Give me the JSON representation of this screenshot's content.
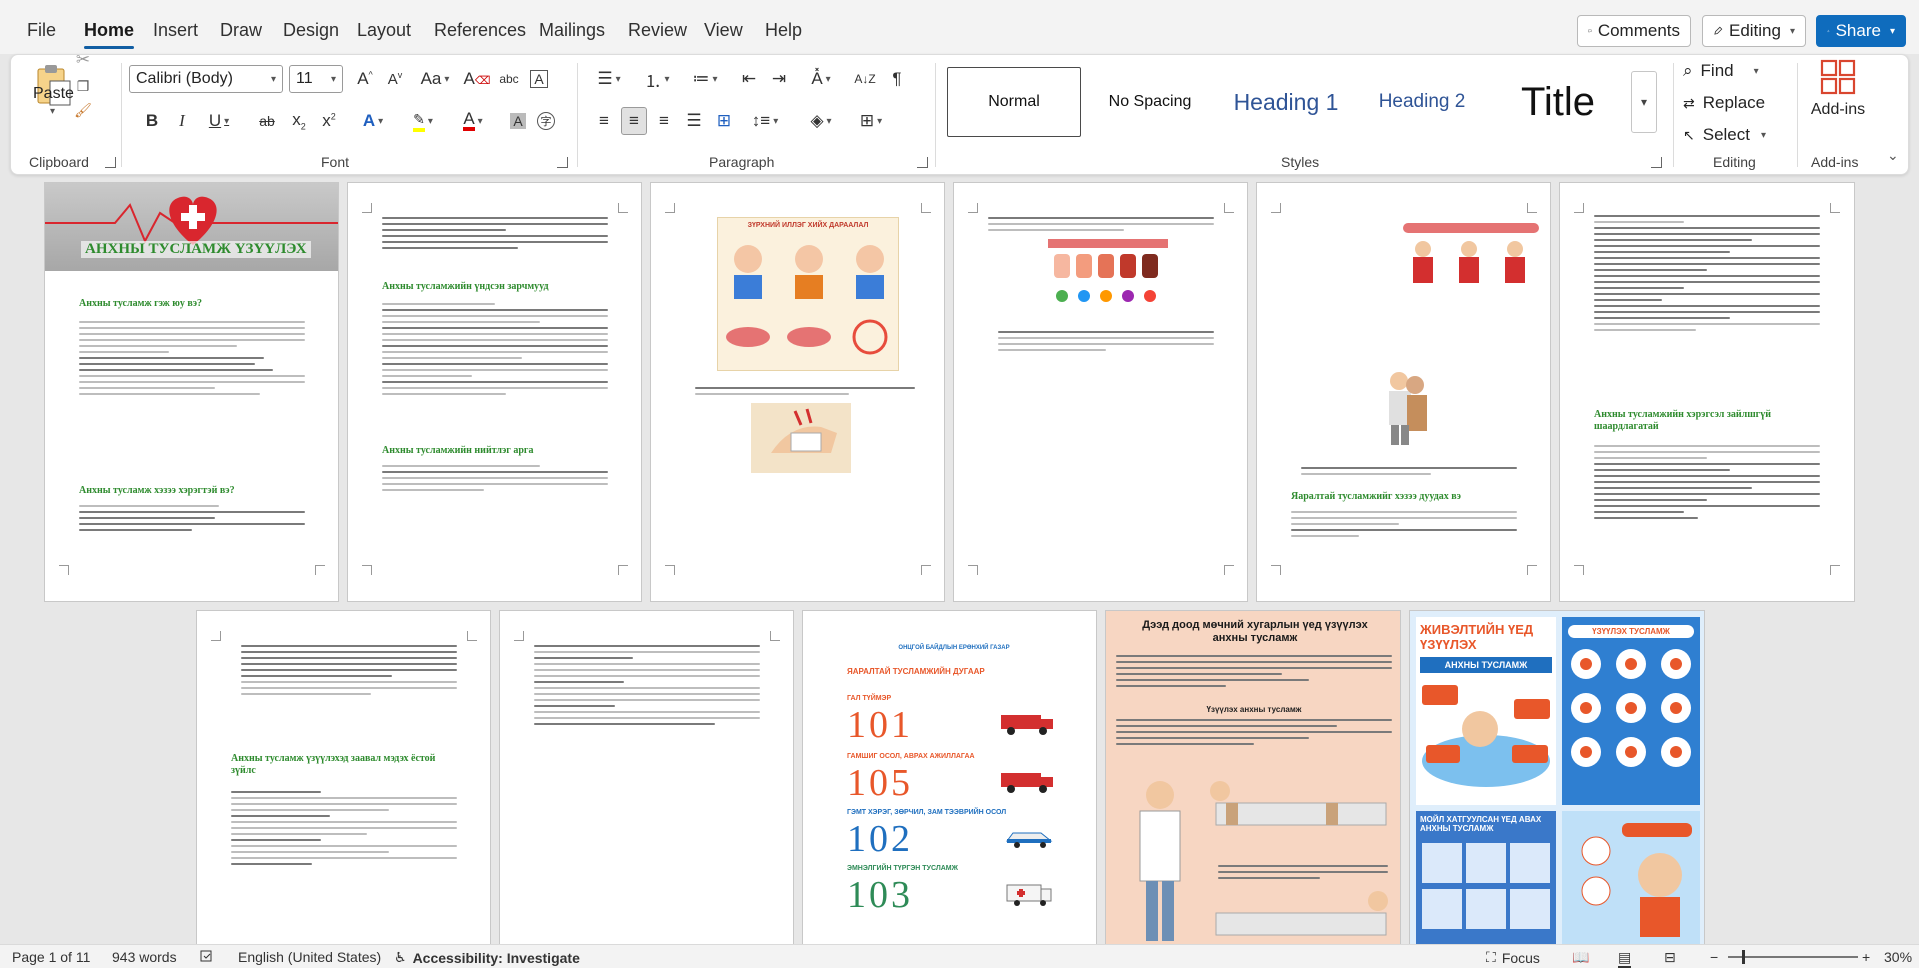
{
  "menu": {
    "tabs": [
      "File",
      "Home",
      "Insert",
      "Draw",
      "Design",
      "Layout",
      "References",
      "Mailings",
      "Review",
      "View",
      "Help"
    ],
    "active_tab": "Home",
    "comments_label": "Comments",
    "editing_label": "Editing",
    "share_label": "Share"
  },
  "ribbon": {
    "clipboard": {
      "paste_label": "Paste",
      "group_label": "Clipboard"
    },
    "font": {
      "font_name": "Calibri (Body)",
      "font_size": "11",
      "group_label": "Font"
    },
    "paragraph": {
      "group_label": "Paragraph"
    },
    "styles": {
      "items": [
        "Normal",
        "No Spacing",
        "Heading 1",
        "Heading 2",
        "Title"
      ],
      "group_label": "Styles"
    },
    "editing": {
      "find_label": "Find",
      "replace_label": "Replace",
      "select_label": "Select",
      "group_label": "Editing"
    },
    "addins": {
      "label": "Add-ins",
      "group_label": "Add-ins"
    }
  },
  "colors": {
    "accent": "#0f6cbd",
    "heading_green": "#2e8b2e",
    "poster_orange": "#e8572a",
    "poster_blue": "#1f6fbf",
    "cover_red": "#d9262e"
  },
  "pages": {
    "p1": {
      "title": "АНХНЫ ТУСЛАМЖ ҮЗҮҮЛЭХ",
      "h1": "Анхны тусламж гэж юу вэ?",
      "h2": "Анхны тусламж хэзээ хэрэгтэй вэ?"
    },
    "p2": {
      "h1": "Анхны тусламжийн үндсэн зарчмууд",
      "h2": "Анхны тусламжийн нийтлэг арга"
    },
    "p3": {
      "poster_title": "ЗҮРХНИЙ ИЛЛЭГ ХИЙХ ДАРААЛАЛ"
    },
    "p5": {
      "h1": "Яаралтай тусламжийг хэзээ дуудах вэ"
    },
    "p6": {
      "h1": "Анхны тусламжийн хэрэгсэл зайлшгүй шаардлагатай"
    },
    "p7": {
      "h1": "Анхны тусламж үзүүлэхэд заавал мэдэх ёстой зүйлс"
    },
    "p9": {
      "agency": "ОНЦГОЙ БАЙДЛЫН ЕРӨНХИЙ ГАЗАР",
      "heading": "ЯАРАЛТАЙ ТУСЛАМЖИЙН ДУГААР",
      "hotlines": [
        {
          "label": "ГАЛ ТҮЙМЭР",
          "number": "101"
        },
        {
          "label": "ГАМШИГ ОСОЛ, АВРАХ АЖИЛЛАГАА",
          "number": "105"
        },
        {
          "label": "ГЭМТ ХЭРЭГ, ЗӨРЧИЛ, ЗАМ ТЭЭВРИЙН ОСОЛ",
          "number": "102"
        },
        {
          "label": "ЭМНЭЛГИЙН ТҮРГЭН ТУСЛАМЖ",
          "number": "103"
        }
      ]
    },
    "p10": {
      "title": "Дээд доод мөчний хугарлын үед үзүүлэх анхны тусламж",
      "subhead": "Үзүүлэх анхны тусламж"
    },
    "p11": {
      "title": "ЖИВЭЛТИЙН ҮЕД ҮЗҮҮЛЭХ",
      "ribbon": "АНХНЫ ТУСЛАМЖ",
      "right_header": "ҮЗҮҮЛЭХ ТУСЛАМЖ",
      "bottom_title": "МОЙЛ ХАТГУУЛСАН ҮЕД АВАХ АНХНЫ ТУСЛАМЖ"
    }
  },
  "status": {
    "page": "Page 1 of 11",
    "words": "943 words",
    "language": "English (United States)",
    "accessibility": "Accessibility: Investigate",
    "focus": "Focus",
    "zoom": "30%"
  }
}
